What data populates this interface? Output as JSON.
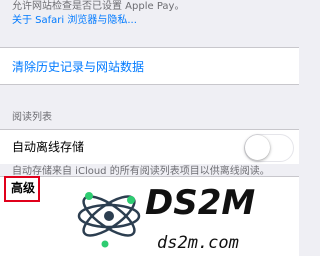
{
  "privacy_footnote": {
    "text": "允许网站检查是否已设置 Apple Pay。",
    "link": "关于 Safari 浏览器与隐私..."
  },
  "clear_history": {
    "label": "清除历史记录与网站数据"
  },
  "reading_list": {
    "section_header": "阅读列表",
    "offline_label": "自动离线存储",
    "offline_enabled": false,
    "footnote": "自动存储来自 iCloud 的所有阅读列表项目以供离线阅读。"
  },
  "advanced": {
    "label": "高级"
  },
  "watermark": {
    "brand": "DS2M",
    "domain": "ds2m.com",
    "colors": {
      "accent": "#2ecc71",
      "ring": "#2c3e50"
    }
  },
  "colors": {
    "background": "#efeff4",
    "link_blue": "#007aff",
    "highlight_red": "#e0001b",
    "secondary_text": "#6d6d72"
  }
}
